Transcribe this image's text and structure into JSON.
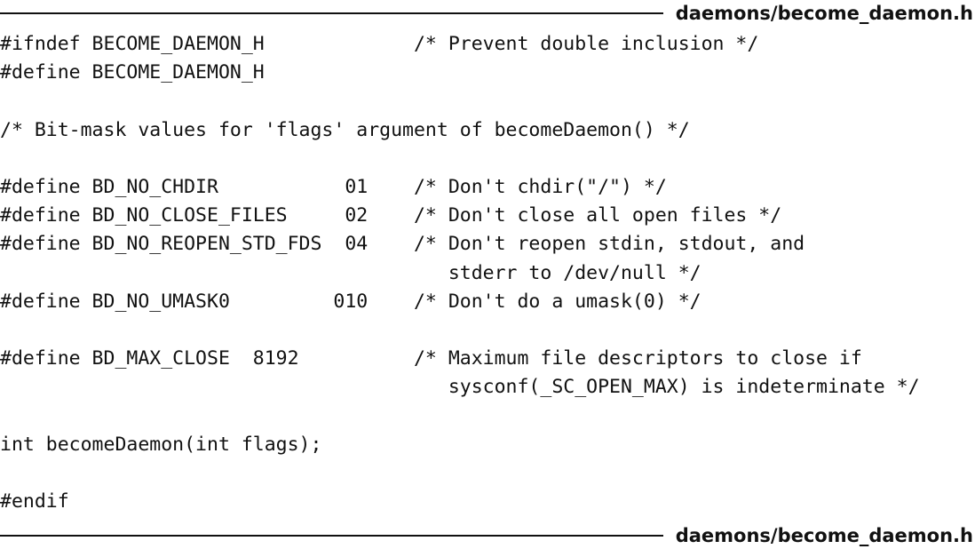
{
  "header": {
    "filename": "daemons/become_daemon.h"
  },
  "footer": {
    "filename": "daemons/become_daemon.h"
  },
  "code": {
    "lines": [
      "#ifndef BECOME_DAEMON_H             /* Prevent double inclusion */",
      "#define BECOME_DAEMON_H",
      "",
      "/* Bit-mask values for 'flags' argument of becomeDaemon() */",
      "",
      "#define BD_NO_CHDIR           01    /* Don't chdir(\"/\") */",
      "#define BD_NO_CLOSE_FILES     02    /* Don't close all open files */",
      "#define BD_NO_REOPEN_STD_FDS  04    /* Don't reopen stdin, stdout, and",
      "                                       stderr to /dev/null */",
      "#define BD_NO_UMASK0         010    /* Don't do a umask(0) */",
      "",
      "#define BD_MAX_CLOSE  8192          /* Maximum file descriptors to close if",
      "                                       sysconf(_SC_OPEN_MAX) is indeterminate */",
      "",
      "int becomeDaemon(int flags);",
      "",
      "#endif"
    ]
  }
}
